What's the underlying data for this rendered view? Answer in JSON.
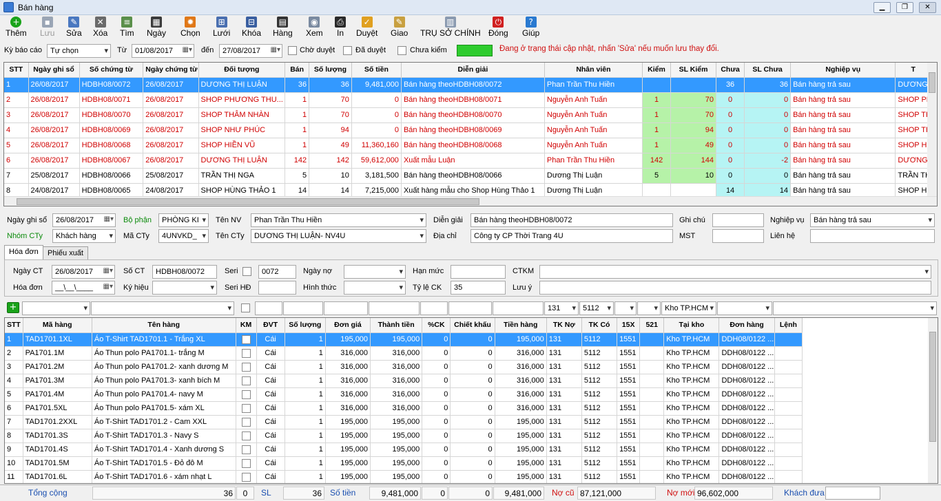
{
  "window": {
    "title": "Bán hàng"
  },
  "toolbar": [
    {
      "label": "Thêm",
      "icon": "add-icon",
      "color": "#1aa31a",
      "enabled": true
    },
    {
      "label": "Lưu",
      "icon": "save-icon",
      "color": "#9aa5b5",
      "enabled": false
    },
    {
      "label": "Sửa",
      "icon": "edit-pencil-icon",
      "color": "#4a78c0",
      "enabled": true
    },
    {
      "label": "Xóa",
      "icon": "delete-x-icon",
      "color": "#6a6a6a",
      "enabled": true
    },
    {
      "label": "Tìm",
      "icon": "find-document-icon",
      "color": "#5a8f4a",
      "enabled": true
    },
    {
      "label": "Ngày",
      "icon": "calendar-icon",
      "color": "#3a3a3a",
      "enabled": true
    },
    {
      "label": "Chọn",
      "icon": "gear-icon",
      "color": "#e07818",
      "enabled": true
    },
    {
      "label": "Lưới",
      "icon": "grid-icon",
      "color": "#4a6fb0",
      "enabled": true
    },
    {
      "label": "Khóa",
      "icon": "lock-icon",
      "color": "#3a5fa0",
      "enabled": true
    },
    {
      "label": "Hàng",
      "icon": "goods-icon",
      "color": "#333333",
      "enabled": true
    },
    {
      "label": "Xem",
      "icon": "preview-icon",
      "color": "#7a8aa0",
      "enabled": true
    },
    {
      "label": "In",
      "icon": "printer-icon",
      "color": "#2a2a2a",
      "enabled": true
    },
    {
      "label": "Duyệt",
      "icon": "approve-icon",
      "color": "#e0a020",
      "enabled": true
    },
    {
      "label": "Giao",
      "icon": "deliver-icon",
      "color": "#c8a040",
      "enabled": true
    },
    {
      "label": "TRỤ SỞ CHÍNH",
      "icon": "headquarters-icon",
      "color": "#8a9ab0",
      "enabled": true
    },
    {
      "label": "Đóng",
      "icon": "power-icon",
      "color": "#d02020",
      "enabled": true
    },
    {
      "label": "Giúp",
      "icon": "help-icon",
      "color": "#2a7ad0",
      "enabled": true
    }
  ],
  "filter": {
    "period_label": "Kỳ báo cáo",
    "period_value": "Tự chọn",
    "from_label": "Từ",
    "from_value": "01/08/2017",
    "to_label": "đến",
    "to_value": "27/08/2017",
    "cb_pending": "Chờ duyệt",
    "cb_approved": "Đã duyệt",
    "cb_unchecked": "Chưa kiểm",
    "status_message": "Đang ở trạng thái cập nhật, nhấn 'Sửa' nếu muốn lưu thay đổi.",
    "status_color": "#d01010"
  },
  "master": {
    "columns": [
      "STT",
      "Ngày ghi sổ",
      "Số chứng từ",
      "Ngày chứng từ",
      "Đối tượng",
      "Bán",
      "Số lượng",
      "Số tiền",
      "Diễn giải",
      "Nhân viên",
      "Kiểm",
      "SL Kiểm",
      "Chưa",
      "SL Chưa",
      "Nghiệp vụ",
      "T"
    ],
    "rows": [
      [
        "1",
        "26/08/2017",
        "HDBH08/0072",
        "26/08/2017",
        "DƯƠNG THỊ LUẬN",
        "36",
        "36",
        "9,481,000",
        "Bán hàng theoHDBH08/0072",
        "Phan Trần Thu Hiền",
        "",
        "",
        "36",
        "36",
        "Bán hàng trả sau",
        "DƯƠNG T"
      ],
      [
        "2",
        "26/08/2017",
        "HDBH08/0071",
        "26/08/2017",
        "SHOP PHƯƠNG THU...",
        "1",
        "70",
        "0",
        "Bán hàng theoHDBH08/0071",
        "Nguyễn Anh Tuấn",
        "1",
        "70",
        "0",
        "0",
        "Bán hàng trả sau",
        "SHOP PH"
      ],
      [
        "3",
        "26/08/2017",
        "HDBH08/0070",
        "26/08/2017",
        "SHOP THÂM NHÀN",
        "1",
        "70",
        "0",
        "Bán hàng theoHDBH08/0070",
        "Nguyễn Anh Tuấn",
        "1",
        "70",
        "0",
        "0",
        "Bán hàng trả sau",
        "SHOP TH"
      ],
      [
        "4",
        "26/08/2017",
        "HDBH08/0069",
        "26/08/2017",
        "SHOP NHƯ PHÚC",
        "1",
        "94",
        "0",
        "Bán hàng theoHDBH08/0069",
        "Nguyễn Anh Tuấn",
        "1",
        "94",
        "0",
        "0",
        "Bán hàng trả sau",
        "SHOP TH"
      ],
      [
        "5",
        "26/08/2017",
        "HDBH08/0068",
        "26/08/2017",
        "SHOP HIỀN VŨ",
        "1",
        "49",
        "11,360,160",
        "Bán hàng theoHDBH08/0068",
        "Nguyễn Anh Tuấn",
        "1",
        "49",
        "0",
        "0",
        "Bán hàng trả sau",
        "SHOP HI"
      ],
      [
        "6",
        "26/08/2017",
        "HDBH08/0067",
        "26/08/2017",
        "DƯƠNG THỊ LUẬN",
        "142",
        "142",
        "59,612,000",
        "Xuất mẫu Luận",
        "Phan Trần Thu Hiền",
        "142",
        "144",
        "0",
        "-2",
        "Bán hàng trả sau",
        "DƯƠNG T"
      ],
      [
        "7",
        "25/08/2017",
        "HDBH08/0066",
        "25/08/2017",
        "TRẦN THỊ NGA",
        "5",
        "10",
        "3,181,500",
        "Bán hàng theoHDBH08/0066",
        "Dương Thị Luận",
        "5",
        "10",
        "0",
        "0",
        "Bán hàng trả sau",
        "TRẦN TH"
      ],
      [
        "8",
        "24/08/2017",
        "HDBH08/0065",
        "24/08/2017",
        "SHOP HÙNG THẢO 1",
        "14",
        "14",
        "7,215,000",
        "Xuất hàng mẫu cho Shop Hùng Thảo 1",
        "Dương Thị Luận",
        "",
        "",
        "14",
        "14",
        "Bán hàng trả sau",
        "SHOP HÙ"
      ]
    ]
  },
  "form": {
    "posting_date_label": "Ngày ghi sổ",
    "posting_date": "26/08/2017",
    "dept_label": "Bộ phận",
    "dept": "PHÒNG KI",
    "staff_label": "Tên NV",
    "staff": "Phan Trần Thu Hiền",
    "desc_label": "Diễn giải",
    "desc": "Bán hàng theoHDBH08/0072",
    "note_label": "Ghi chú",
    "note": "",
    "op_label": "Nghiệp vụ",
    "op": "Bán hàng trả sau",
    "group_label": "Nhóm CTy",
    "group": "Khách hàng",
    "code_label": "Mã CTy",
    "code": "4UNVKD_",
    "company_label": "Tên CTy",
    "company": "DƯƠNG THỊ LUẬN- NV4U",
    "address_label": "Địa chỉ",
    "address": "Công ty CP Thời Trang 4U",
    "tax_label": "MST",
    "tax": "",
    "contact_label": "Liên hệ",
    "contact": ""
  },
  "tabs": [
    "Hóa đơn",
    "Phiếu xuất"
  ],
  "invoice": {
    "ct_date_label": "Ngày CT",
    "ct_date": "26/08/2017",
    "ct_no_label": "Số CT",
    "ct_no": "HDBH08/0072",
    "seri_label": "Seri",
    "seri": "0072",
    "due_label": "Ngày nợ",
    "due": "",
    "limit_label": "Hạn mức",
    "limit": "",
    "promo_label": "CTKM",
    "promo": "",
    "inv_label": "Hóa đơn",
    "inv": "__\\__\\____",
    "symbol_label": "Ký hiệu",
    "symbol": "",
    "serihd_label": "Seri HĐ",
    "serihd": "",
    "form_label": "Hình thức",
    "form": "",
    "disc_label": "Tỷ lệ CK",
    "disc": "35",
    "warn_label": "Lưu ý",
    "warn": ""
  },
  "entry_row": {
    "tk_no": "131",
    "tk_co": "5112",
    "store": "Kho TP.HCM"
  },
  "detail": {
    "columns": [
      "STT",
      "Mã hàng",
      "Tên hàng",
      "KM",
      "ĐVT",
      "Số lượng",
      "Đơn giá",
      "Thành tiền",
      "%CK",
      "Chiết khấu",
      "Tiền hàng",
      "TK Nợ",
      "TK Có",
      "15X",
      "521",
      "Tại kho",
      "Đơn hàng",
      "Lệnh"
    ],
    "rows": [
      [
        "1",
        "TAD1701.1XL",
        "Áo T-Shirt TAD1701.1 - Trắng XL",
        "",
        "Cái",
        "1",
        "195,000",
        "195,000",
        "0",
        "0",
        "195,000",
        "131",
        "5112",
        "1551",
        "",
        "Kho TP.HCM",
        "DDH08/0122 ...",
        ""
      ],
      [
        "2",
        "PA1701.1M",
        "Áo Thun polo PA1701.1- trắng M",
        "",
        "Cái",
        "1",
        "316,000",
        "316,000",
        "0",
        "0",
        "316,000",
        "131",
        "5112",
        "1551",
        "",
        "Kho TP.HCM",
        "DDH08/0122 ...",
        ""
      ],
      [
        "3",
        "PA1701.2M",
        "Áo Thun polo PA1701.2- xanh dương M",
        "",
        "Cái",
        "1",
        "316,000",
        "316,000",
        "0",
        "0",
        "316,000",
        "131",
        "5112",
        "1551",
        "",
        "Kho TP.HCM",
        "DDH08/0122 ...",
        ""
      ],
      [
        "4",
        "PA1701.3M",
        "Áo Thun polo PA1701.3- xanh bích M",
        "",
        "Cái",
        "1",
        "316,000",
        "316,000",
        "0",
        "0",
        "316,000",
        "131",
        "5112",
        "1551",
        "",
        "Kho TP.HCM",
        "DDH08/0122 ...",
        ""
      ],
      [
        "5",
        "PA1701.4M",
        "Áo Thun polo PA1701.4- navy M",
        "",
        "Cái",
        "1",
        "316,000",
        "316,000",
        "0",
        "0",
        "316,000",
        "131",
        "5112",
        "1551",
        "",
        "Kho TP.HCM",
        "DDH08/0122 ...",
        ""
      ],
      [
        "6",
        "PA1701.5XL",
        "Áo Thun polo PA1701.5- xám XL",
        "",
        "Cái",
        "1",
        "316,000",
        "316,000",
        "0",
        "0",
        "316,000",
        "131",
        "5112",
        "1551",
        "",
        "Kho TP.HCM",
        "DDH08/0122 ...",
        ""
      ],
      [
        "7",
        "TAD1701.2XXL",
        "Áo T-Shirt TAD1701.2 - Cam XXL",
        "",
        "Cái",
        "1",
        "195,000",
        "195,000",
        "0",
        "0",
        "195,000",
        "131",
        "5112",
        "1551",
        "",
        "Kho TP.HCM",
        "DDH08/0122 ...",
        ""
      ],
      [
        "8",
        "TAD1701.3S",
        "Áo T-Shirt TAD1701.3 - Navy S",
        "",
        "Cái",
        "1",
        "195,000",
        "195,000",
        "0",
        "0",
        "195,000",
        "131",
        "5112",
        "1551",
        "",
        "Kho TP.HCM",
        "DDH08/0122 ...",
        ""
      ],
      [
        "9",
        "TAD1701.4S",
        "Áo T-Shirt TAD1701.4 - Xanh dương S",
        "",
        "Cái",
        "1",
        "195,000",
        "195,000",
        "0",
        "0",
        "195,000",
        "131",
        "5112",
        "1551",
        "",
        "Kho TP.HCM",
        "DDH08/0122 ...",
        ""
      ],
      [
        "10",
        "TAD1701.5M",
        "Áo T-Shirt TAD1701.5 - Đỏ đô M",
        "",
        "Cái",
        "1",
        "195,000",
        "195,000",
        "0",
        "0",
        "195,000",
        "131",
        "5112",
        "1551",
        "",
        "Kho TP.HCM",
        "DDH08/0122 ...",
        ""
      ],
      [
        "11",
        "TAD1701.6L",
        "Áo T-Shirt TAD1701.6 - xám nhạt L",
        "",
        "Cái",
        "1",
        "195,000",
        "195,000",
        "0",
        "0",
        "195,000",
        "131",
        "5112",
        "1551",
        "",
        "Kho TP.HCM",
        "DDH08/0122 ...",
        ""
      ]
    ]
  },
  "footer": {
    "total_label": "Tổng cộng",
    "total_qty": "36",
    "total_km": "0",
    "sl_label": "SL",
    "sl": "36",
    "amount_label": "Số tiền",
    "amount": "9,481,000",
    "ck": "0",
    "ck2": "0",
    "goods": "9,481,000",
    "old_debt_label": "Nợ cũ",
    "old_debt": "87,121,000",
    "new_debt_label": "Nợ mới",
    "new_debt": "96,602,000",
    "paid_label": "Khách đưa",
    "paid": ""
  }
}
